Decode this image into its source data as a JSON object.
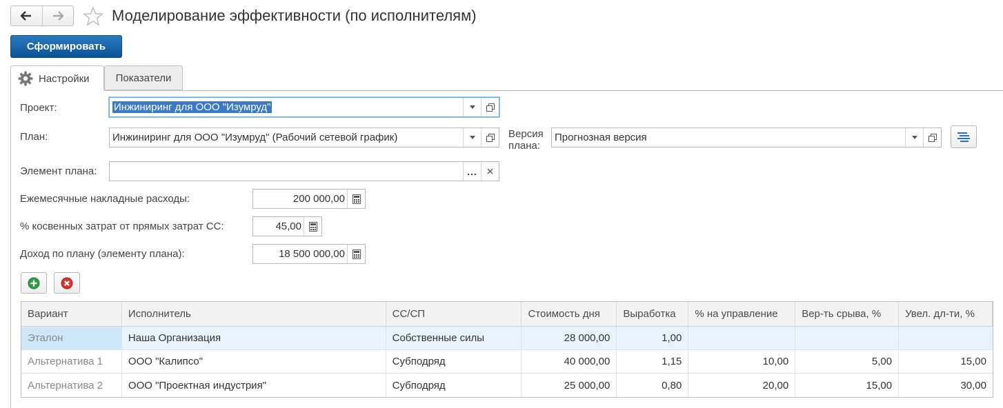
{
  "header": {
    "title": "Моделирование эффективности (по исполнителям)",
    "generate_button": "Сформировать"
  },
  "tabs": [
    {
      "label": "Настройки",
      "active": true,
      "icon": "gear-icon"
    },
    {
      "label": "Показатели",
      "active": false
    }
  ],
  "form": {
    "project": {
      "label": "Проект:",
      "value": "Инжиниринг для ООО \"Изумруд\""
    },
    "plan": {
      "label": "План:",
      "value": "Инжиниринг для ООО \"Изумруд\" (Рабочий сетевой график)"
    },
    "plan_version": {
      "label_line1": "Версия",
      "label_line2": "плана:",
      "value": "Прогнозная версия"
    },
    "plan_element": {
      "label": "Элемент плана:",
      "value": "",
      "choose_button": "..."
    },
    "monthly_overhead": {
      "label": "Ежемесячные накладные расходы:",
      "value": "200 000,00"
    },
    "indirect_percent": {
      "label": "% косвенных затрат от прямых затрат СС:",
      "value": "45,00"
    },
    "plan_income": {
      "label": "Доход по плану (элементу плана):",
      "value": "18 500 000,00"
    }
  },
  "table": {
    "columns": [
      "Вариант",
      "Исполнитель",
      "СС/СП",
      "Стоимость дня",
      "Выработка",
      "% на управление",
      "Вер-ть срыва, %",
      "Увел. дл-ти, %"
    ],
    "rows": [
      {
        "variant": "Эталон",
        "executor": "Наша Организация",
        "type": "Собственные силы",
        "day_cost": "28 000,00",
        "output": "1,00",
        "mgmt": "",
        "risk": "",
        "increase": ""
      },
      {
        "variant": "Альтернатива 1",
        "executor": "ООО \"Калипсо\"",
        "type": "Субподряд",
        "day_cost": "40 000,00",
        "output": "1,15",
        "mgmt": "10,00",
        "risk": "5,00",
        "increase": "15,00"
      },
      {
        "variant": "Альтернатива 2",
        "executor": "ООО \"Проектная индустрия\"",
        "type": "Субподряд",
        "day_cost": "25 000,00",
        "output": "0,80",
        "mgmt": "20,00",
        "risk": "15,00",
        "increase": "30,00"
      }
    ]
  },
  "colors": {
    "primary": "#1560a8",
    "add": "#2ea043",
    "delete": "#d9342b",
    "selection": "#e7f3fc"
  }
}
